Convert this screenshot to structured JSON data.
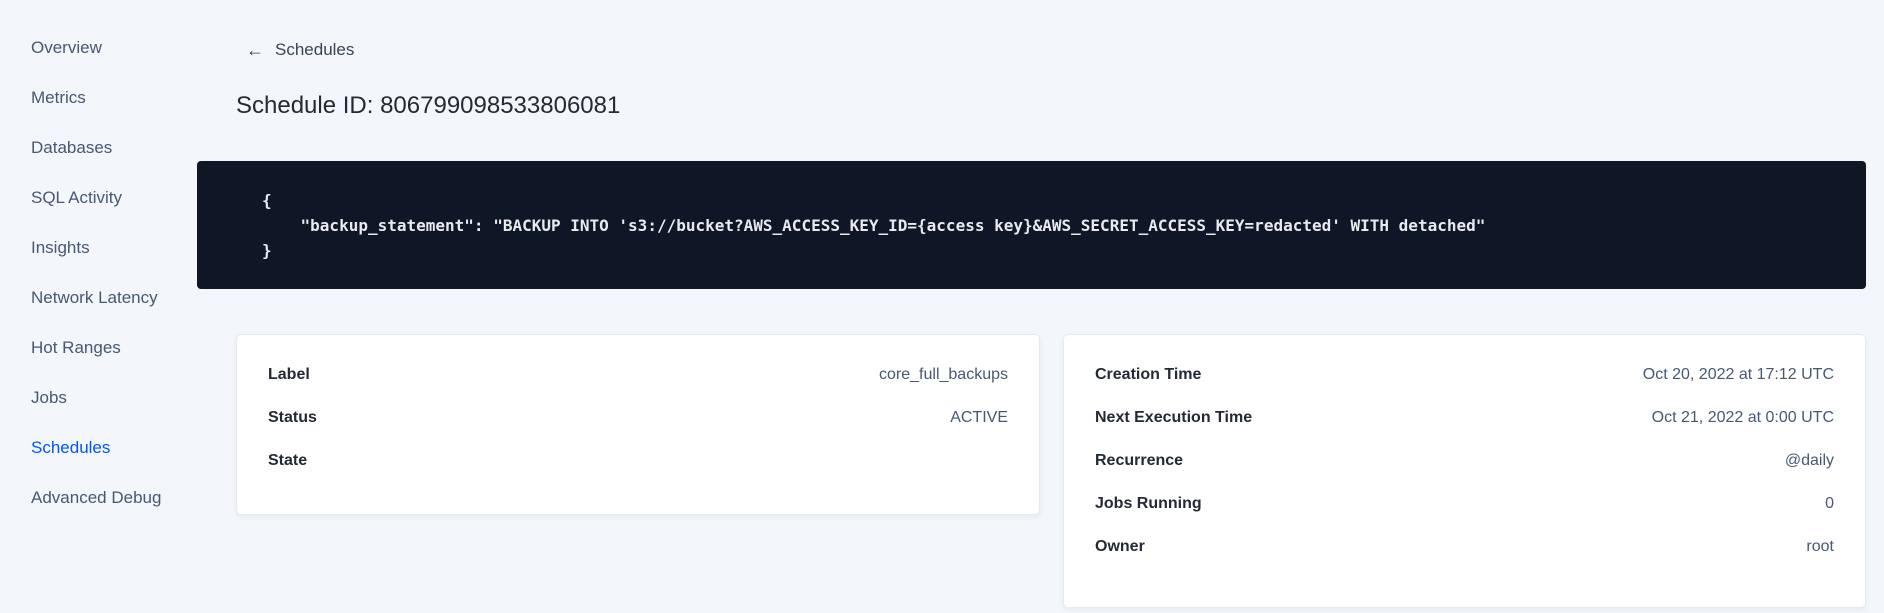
{
  "sidebar": {
    "items": [
      {
        "label": "Overview",
        "active": false
      },
      {
        "label": "Metrics",
        "active": false
      },
      {
        "label": "Databases",
        "active": false
      },
      {
        "label": "SQL Activity",
        "active": false
      },
      {
        "label": "Insights",
        "active": false
      },
      {
        "label": "Network Latency",
        "active": false
      },
      {
        "label": "Hot Ranges",
        "active": false
      },
      {
        "label": "Jobs",
        "active": false
      },
      {
        "label": "Schedules",
        "active": true
      },
      {
        "label": "Advanced Debug",
        "active": false
      }
    ]
  },
  "header": {
    "back_icon": "←",
    "back_label": "Schedules",
    "title": "Schedule ID: 806799098533806081"
  },
  "code_block": {
    "lines": [
      "{",
      "    \"backup_statement\": \"BACKUP INTO 's3://bucket?AWS_ACCESS_KEY_ID={access key}&AWS_SECRET_ACCESS_KEY=redacted' WITH detached\"",
      "}"
    ]
  },
  "cards": {
    "left": {
      "rows": [
        {
          "label": "Label",
          "value": "core_full_backups"
        },
        {
          "label": "Status",
          "value": "ACTIVE"
        },
        {
          "label": "State",
          "value": ""
        }
      ]
    },
    "right": {
      "rows": [
        {
          "label": "Creation Time",
          "value": "Oct 20, 2022 at 17:12 UTC"
        },
        {
          "label": "Next Execution Time",
          "value": "Oct 21, 2022 at 0:00 UTC"
        },
        {
          "label": "Recurrence",
          "value": "@daily"
        },
        {
          "label": "Jobs Running",
          "value": "0"
        },
        {
          "label": "Owner",
          "value": "root"
        }
      ]
    }
  },
  "colors": {
    "accent_blue": "#0055ff",
    "page_background": "#f3f6fa",
    "code_background": "#0f1625",
    "code_text": "#e7ebf0"
  }
}
